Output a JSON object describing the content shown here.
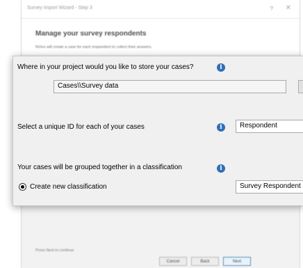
{
  "wizard": {
    "title": "Survey Import Wizard - Step 3",
    "help_glyph": "?",
    "close_glyph": "✕",
    "heading": "Manage your survey respondents",
    "subtitle": "NVivo will create a case for each respondent to collect their answers.",
    "footer_text": "Press Next to continue",
    "buttons": {
      "cancel": "Cancel",
      "back": "Back",
      "next": "Next"
    }
  },
  "panel": {
    "store_question": "Where in your project would you like to store your cases?",
    "store_location": "Cases\\\\Survey data",
    "unique_id_label": "Select a unique ID for each of your cases",
    "unique_id_value": "Respondent",
    "classification_label": "Your cases will be grouped together in a classification",
    "create_new_label": "Create new classification",
    "classification_name": "Survey Respondent",
    "info_glyph": "i"
  },
  "colors": {
    "info_icon": "#2f6fb5",
    "dialog_background": "#f0f0f0"
  }
}
